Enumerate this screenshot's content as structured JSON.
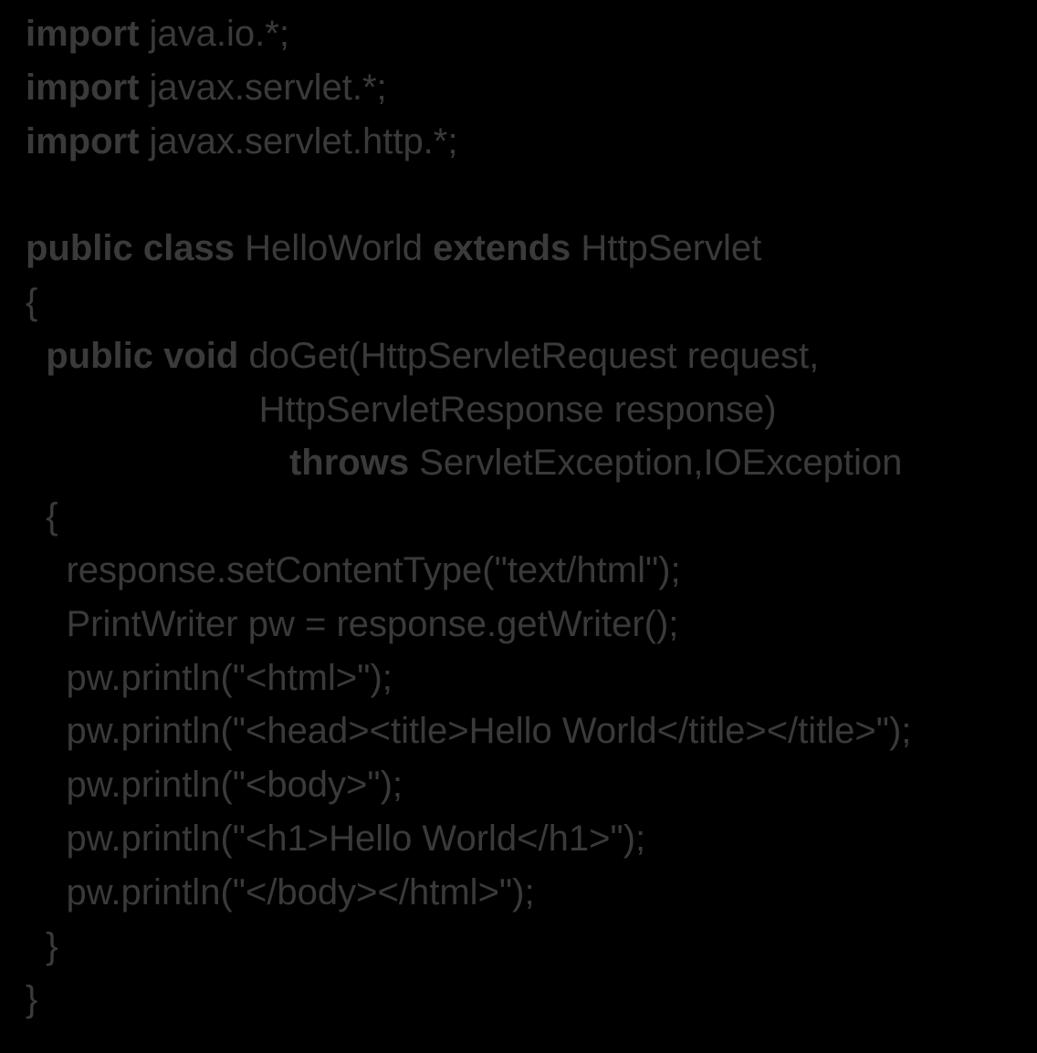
{
  "code": {
    "lines": [
      [
        {
          "t": "import ",
          "kw": true
        },
        {
          "t": "java.io.*;",
          "kw": false
        }
      ],
      [
        {
          "t": "import ",
          "kw": true
        },
        {
          "t": "javax.servlet.*;",
          "kw": false
        }
      ],
      [
        {
          "t": "import ",
          "kw": true
        },
        {
          "t": "javax.servlet.http.*;",
          "kw": false
        }
      ],
      [
        {
          "t": "",
          "kw": false
        }
      ],
      [
        {
          "t": "public class ",
          "kw": true
        },
        {
          "t": "HelloWorld ",
          "kw": false
        },
        {
          "t": "extends ",
          "kw": true
        },
        {
          "t": "HttpServlet",
          "kw": false
        }
      ],
      [
        {
          "t": "{",
          "kw": false
        }
      ],
      [
        {
          "t": "  public void ",
          "kw": true
        },
        {
          "t": "doGet(HttpServletRequest request,",
          "kw": false
        }
      ],
      [
        {
          "t": "                       HttpServletResponse response)",
          "kw": false
        }
      ],
      [
        {
          "t": "                          ",
          "kw": false
        },
        {
          "t": "throws ",
          "kw": true
        },
        {
          "t": "ServletException,IOException",
          "kw": false
        }
      ],
      [
        {
          "t": "  {",
          "kw": false
        }
      ],
      [
        {
          "t": "    response.setContentType(\"text/html\");",
          "kw": false
        }
      ],
      [
        {
          "t": "    PrintWriter pw = response.getWriter();",
          "kw": false
        }
      ],
      [
        {
          "t": "    pw.println(\"<html>\");",
          "kw": false
        }
      ],
      [
        {
          "t": "    pw.println(\"<head><title>Hello World</title></title>\");",
          "kw": false
        }
      ],
      [
        {
          "t": "    pw.println(\"<body>\");",
          "kw": false
        }
      ],
      [
        {
          "t": "    pw.println(\"<h1>Hello World</h1>\");",
          "kw": false
        }
      ],
      [
        {
          "t": "    pw.println(\"</body></html>\");",
          "kw": false
        }
      ],
      [
        {
          "t": "  }",
          "kw": false
        }
      ],
      [
        {
          "t": "}",
          "kw": false
        }
      ]
    ]
  }
}
